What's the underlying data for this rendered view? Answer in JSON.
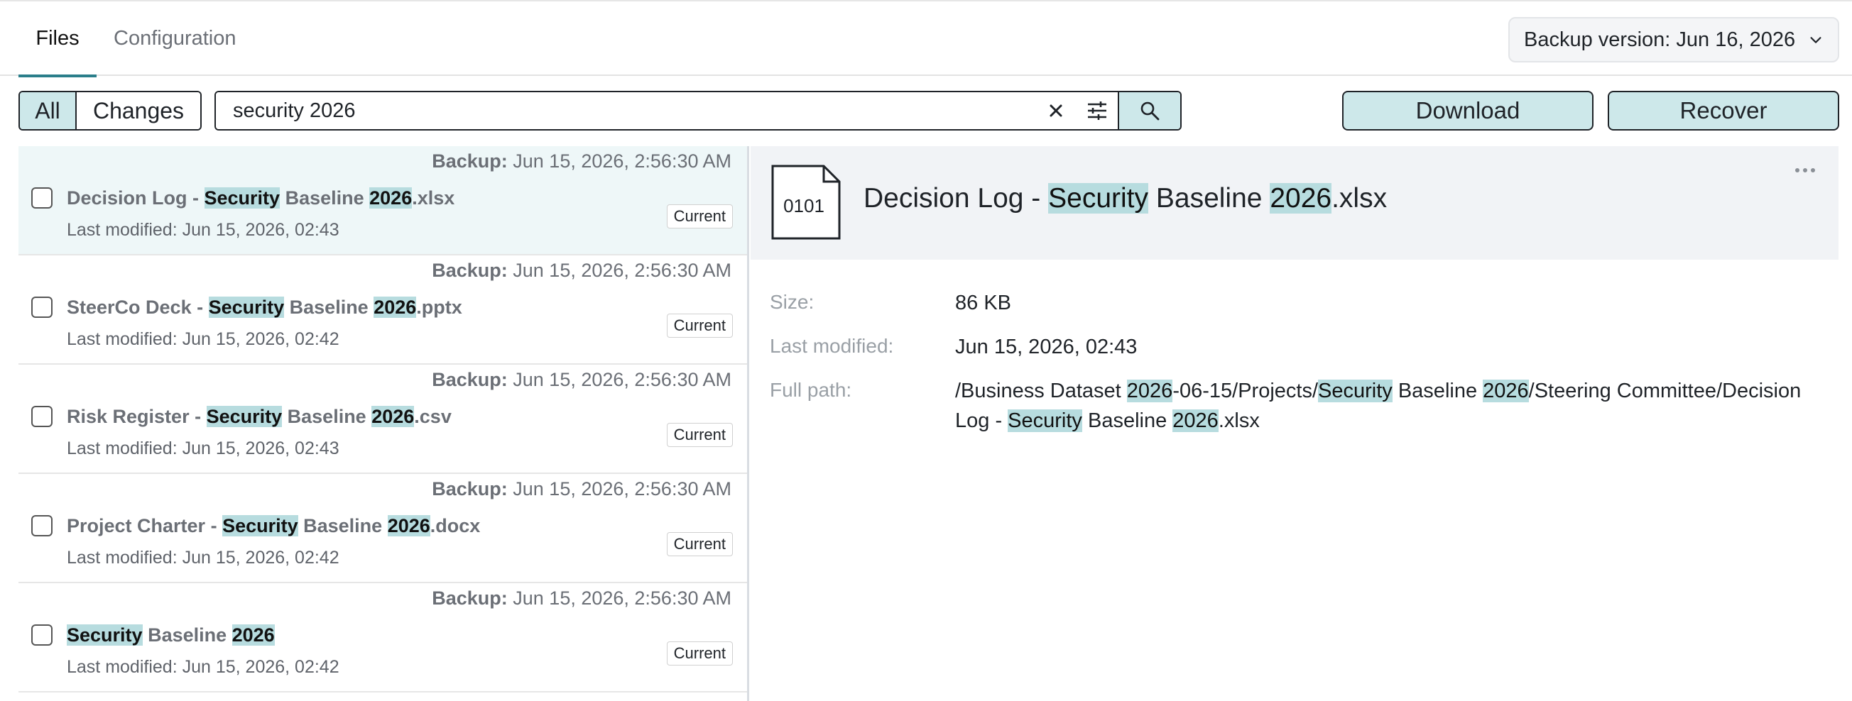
{
  "tabs": {
    "files": "Files",
    "configuration": "Configuration"
  },
  "version": {
    "label": "Backup version: Jun 16, 2026"
  },
  "filter": {
    "all": "All",
    "changes": "Changes"
  },
  "search": {
    "value": "security 2026"
  },
  "actions": {
    "download": "Download",
    "recover": "Recover"
  },
  "list": {
    "backup_prefix": "Backup:",
    "items": [
      {
        "backup": "Jun 15, 2026, 2:56:30 AM",
        "name_parts": [
          {
            "t": "Decision Log - "
          },
          {
            "t": "Security",
            "hl": true
          },
          {
            "t": " Baseline "
          },
          {
            "t": "2026",
            "hl": true
          },
          {
            "t": ".xlsx"
          }
        ],
        "modified": "Last modified: Jun 15, 2026, 02:43",
        "badge": "Current",
        "selected": true
      },
      {
        "backup": "Jun 15, 2026, 2:56:30 AM",
        "name_parts": [
          {
            "t": "SteerCo Deck - "
          },
          {
            "t": "Security",
            "hl": true
          },
          {
            "t": " Baseline "
          },
          {
            "t": "2026",
            "hl": true
          },
          {
            "t": ".pptx"
          }
        ],
        "modified": "Last modified: Jun 15, 2026, 02:42",
        "badge": "Current"
      },
      {
        "backup": "Jun 15, 2026, 2:56:30 AM",
        "name_parts": [
          {
            "t": "Risk Register - "
          },
          {
            "t": "Security",
            "hl": true
          },
          {
            "t": " Baseline "
          },
          {
            "t": "2026",
            "hl": true
          },
          {
            "t": ".csv"
          }
        ],
        "modified": "Last modified: Jun 15, 2026, 02:43",
        "badge": "Current"
      },
      {
        "backup": "Jun 15, 2026, 2:56:30 AM",
        "name_parts": [
          {
            "t": "Project Charter - "
          },
          {
            "t": "Security",
            "hl": true
          },
          {
            "t": " Baseline "
          },
          {
            "t": "2026",
            "hl": true
          },
          {
            "t": ".docx"
          }
        ],
        "modified": "Last modified: Jun 15, 2026, 02:42",
        "badge": "Current"
      },
      {
        "backup": "Jun 15, 2026, 2:56:30 AM",
        "name_parts": [
          {
            "t": "Security",
            "hl": true
          },
          {
            "t": " Baseline "
          },
          {
            "t": "2026",
            "hl": true
          }
        ],
        "modified": "Last modified: Jun 15, 2026, 02:42",
        "badge": "Current"
      }
    ]
  },
  "detail": {
    "icon_text": "0101",
    "title_parts": [
      {
        "t": "Decision Log - "
      },
      {
        "t": "Security",
        "hl": true
      },
      {
        "t": " Baseline "
      },
      {
        "t": "2026",
        "hl": true
      },
      {
        "t": ".xlsx"
      }
    ],
    "size_label": "Size:",
    "size_value": "86 KB",
    "modified_label": "Last modified:",
    "modified_value": "Jun 15, 2026, 02:43",
    "path_label": "Full path:",
    "path_parts": [
      {
        "t": "/Business Dataset "
      },
      {
        "t": "2026",
        "hl": true
      },
      {
        "t": "-06-15/Projects/"
      },
      {
        "t": "Security",
        "hl": true
      },
      {
        "t": " Baseline "
      },
      {
        "t": "2026",
        "hl": true
      },
      {
        "t": "/Steering Committee/Decision Log - "
      },
      {
        "t": "Security",
        "hl": true
      },
      {
        "t": " Baseline "
      },
      {
        "t": "2026",
        "hl": true
      },
      {
        "t": ".xlsx"
      }
    ]
  },
  "colors": {
    "accent": "#2a7e8a",
    "button_fill": "#cde8ea",
    "highlight": "#b7dcdf",
    "selected_row": "#eef7f8"
  }
}
